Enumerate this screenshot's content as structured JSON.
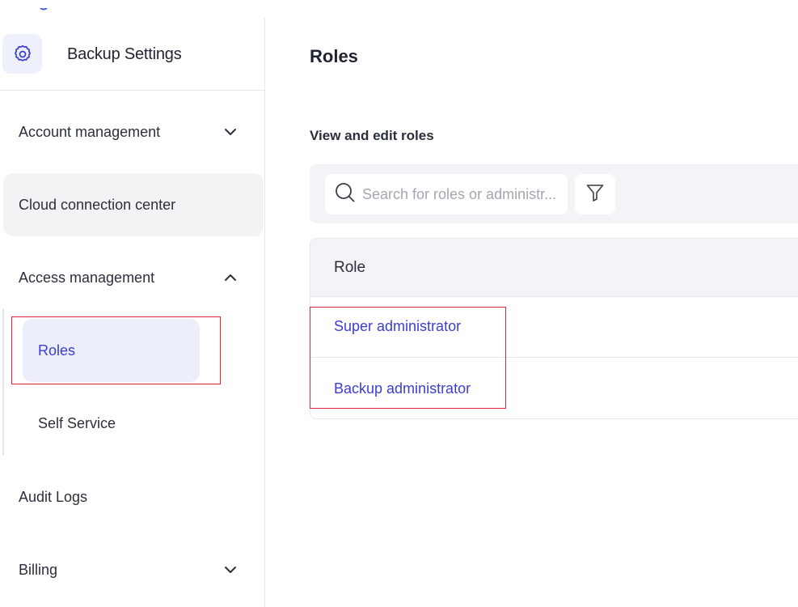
{
  "sidebar": {
    "title": "Backup Settings",
    "items": [
      {
        "label": "Account management",
        "icon": "chevron-down-icon"
      },
      {
        "label": "Cloud connection center"
      },
      {
        "label": "Access management",
        "icon": "chevron-up-icon"
      },
      {
        "label": "Audit Logs"
      },
      {
        "label": "Billing",
        "icon": "chevron-down-icon"
      }
    ],
    "access_sub": [
      {
        "label": "Roles",
        "selected": true
      },
      {
        "label": "Self Service"
      }
    ]
  },
  "main": {
    "title": "Roles",
    "section_label": "View and edit roles",
    "search_placeholder": "Search for roles or administr...",
    "table": {
      "header": "Role",
      "rows": [
        "Super administrator",
        "Backup administrator"
      ]
    }
  },
  "colors": {
    "accent": "#3b3fd0",
    "highlight_border": "#e0263a",
    "selected_bg": "#eceefc",
    "hover_bg": "#f3f3f5"
  }
}
